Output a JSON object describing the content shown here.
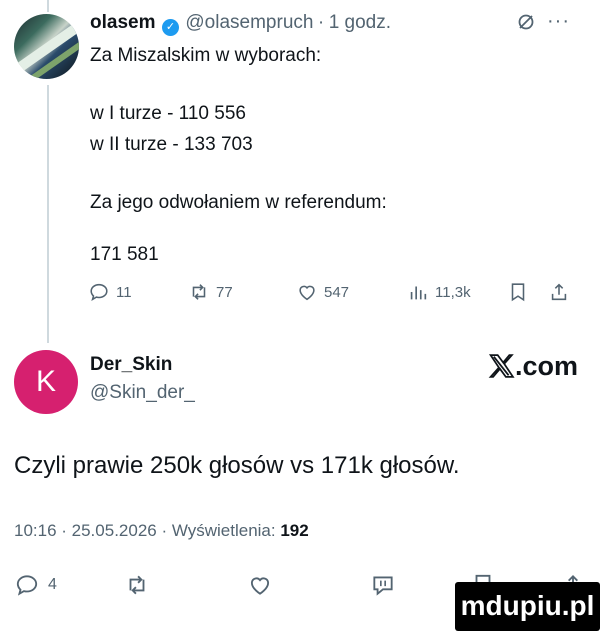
{
  "tweet": {
    "author_name": "olasem",
    "author_handle": "@olasempruch",
    "separator": "·",
    "time": "1 godz.",
    "lines": [
      "Za Miszalskim w wyborach:",
      "w I turze - 110 556",
      "w II turze - 133 703",
      "Za jego odwołaniem w referendum:",
      "171 581"
    ],
    "actions": {
      "replies": "11",
      "reposts": "77",
      "likes": "547",
      "views": "11,3k"
    }
  },
  "reply": {
    "author_name": "Der_Skin",
    "author_handle": "@Skin_der_",
    "avatar_letter": "K",
    "avatar_color": "#d6206f",
    "brand": ".com",
    "text": "Czyli prawie 250k głosów vs 171k głosów.",
    "timestamp": "10:16 · 25.05.2026 · Wyświetlenia:",
    "views_count": "192",
    "replies": "4"
  },
  "watermark": "mdupiu.pl",
  "colors": {
    "muted": "#536471",
    "verified": "#1d9bf0",
    "thread_line": "#cfd9de"
  }
}
